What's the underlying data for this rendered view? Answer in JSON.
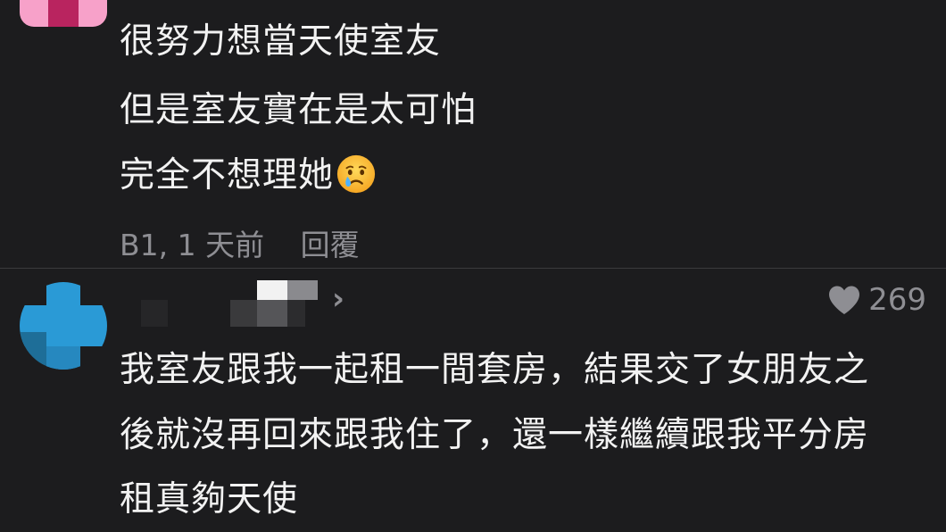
{
  "comment_prev": {
    "lines": [
      "很努力想當天使室友",
      "但是室友實在是太可怕",
      "完全不想理她"
    ],
    "emoji": "crying-face",
    "floor_time": "B1, 1 天前",
    "reply_label": "回覆"
  },
  "comment_next": {
    "likes": "269",
    "lines": [
      "我室友跟我一起租一間套房，結果交了女朋友之",
      "後就沒再回來跟我住了，還一樣繼續跟我平分房",
      "租真夠天使"
    ]
  },
  "colors": {
    "background": "#1c1c1e",
    "text": "#f2f2f2",
    "muted": "#8e8e93",
    "avatar_blue": "#2a9ad6",
    "avatar_pink": "#f7a1c9"
  }
}
